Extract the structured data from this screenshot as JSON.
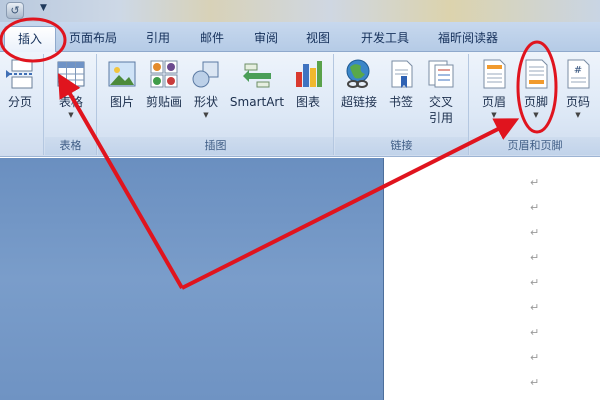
{
  "quick_access": {
    "undo_icon": "undo-icon",
    "dropdown_icon": "dropdown-arrow-icon"
  },
  "tabs": [
    {
      "label": "插入",
      "active": true
    },
    {
      "label": "页面布局"
    },
    {
      "label": "引用"
    },
    {
      "label": "邮件"
    },
    {
      "label": "审阅"
    },
    {
      "label": "视图"
    },
    {
      "label": "开发工具"
    },
    {
      "label": "福昕阅读器"
    }
  ],
  "ribbon": {
    "groups": [
      {
        "label": "",
        "buttons": [
          {
            "label": "分页",
            "icon": "page-break-icon"
          }
        ]
      },
      {
        "label": "表格",
        "buttons": [
          {
            "label": "表格",
            "icon": "table-icon"
          }
        ]
      },
      {
        "label": "插图",
        "buttons": [
          {
            "label": "图片",
            "icon": "picture-icon"
          },
          {
            "label": "剪贴画",
            "icon": "clipart-icon"
          },
          {
            "label": "形状",
            "icon": "shapes-icon"
          },
          {
            "label": "SmartArt",
            "icon": "smartart-icon"
          },
          {
            "label": "图表",
            "icon": "chart-icon"
          }
        ]
      },
      {
        "label": "链接",
        "buttons": [
          {
            "label": "超链接",
            "icon": "hyperlink-icon"
          },
          {
            "label": "书签",
            "icon": "bookmark-icon"
          },
          {
            "label": "交叉\n引用",
            "icon": "cross-reference-icon"
          }
        ]
      },
      {
        "label": "页眉和页脚",
        "buttons": [
          {
            "label": "页眉",
            "icon": "header-icon"
          },
          {
            "label": "页脚",
            "icon": "footer-icon"
          },
          {
            "label": "页码",
            "icon": "page-number-icon"
          }
        ]
      }
    ]
  },
  "document": {
    "paragraph_mark": "↵",
    "paragraph_count": 9
  },
  "colors": {
    "annotation": "#e0141e",
    "ribbon_text": "#1c2f4d",
    "doc_background": "#7398c8"
  }
}
